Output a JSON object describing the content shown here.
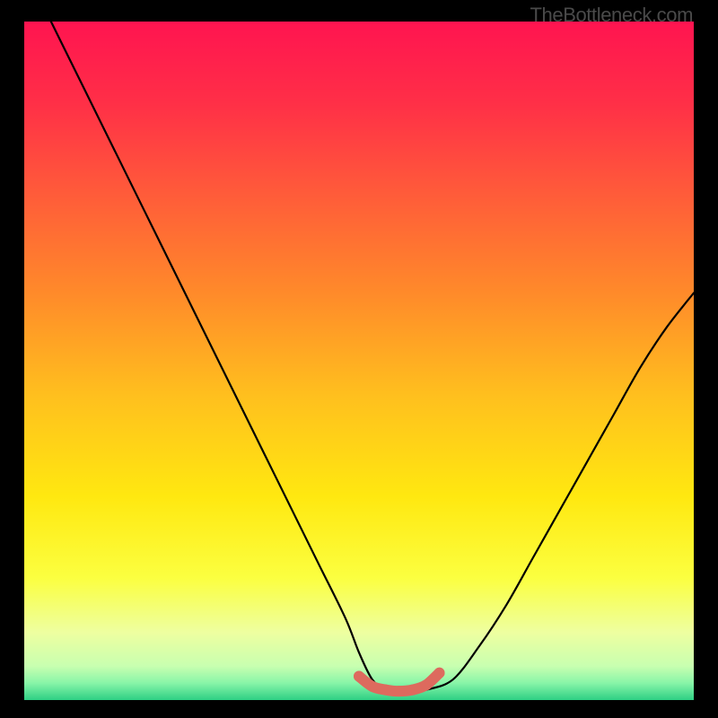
{
  "watermark": "TheBottleneck.com",
  "chart_data": {
    "type": "line",
    "title": "",
    "xlabel": "",
    "ylabel": "",
    "xlim": [
      0,
      100
    ],
    "ylim": [
      0,
      100
    ],
    "background": {
      "type": "vertical-gradient",
      "stops": [
        {
          "pos": 0.0,
          "color": "#ff1450"
        },
        {
          "pos": 0.12,
          "color": "#ff2f47"
        },
        {
          "pos": 0.25,
          "color": "#ff5a3a"
        },
        {
          "pos": 0.4,
          "color": "#ff8a2a"
        },
        {
          "pos": 0.55,
          "color": "#ffbf1e"
        },
        {
          "pos": 0.7,
          "color": "#ffe810"
        },
        {
          "pos": 0.82,
          "color": "#fbff40"
        },
        {
          "pos": 0.9,
          "color": "#eeffa0"
        },
        {
          "pos": 0.95,
          "color": "#c8ffb0"
        },
        {
          "pos": 0.975,
          "color": "#88f5a8"
        },
        {
          "pos": 1.0,
          "color": "#2ecf84"
        }
      ]
    },
    "series": [
      {
        "name": "bottleneck-curve",
        "color": "#000000",
        "x": [
          4,
          8,
          12,
          16,
          20,
          24,
          28,
          32,
          36,
          40,
          44,
          48,
          50,
          52,
          54,
          56,
          58,
          60,
          64,
          68,
          72,
          76,
          80,
          84,
          88,
          92,
          96,
          100
        ],
        "y": [
          100,
          92,
          84,
          76,
          68,
          60,
          52,
          44,
          36,
          28,
          20,
          12,
          7,
          3,
          1.5,
          1.2,
          1.2,
          1.5,
          3,
          8,
          14,
          21,
          28,
          35,
          42,
          49,
          55,
          60
        ]
      },
      {
        "name": "sweet-spot-highlight",
        "color": "#e06a60",
        "x": [
          50,
          52,
          54,
          56,
          58,
          60,
          62
        ],
        "y": [
          3.5,
          2.0,
          1.5,
          1.3,
          1.5,
          2.2,
          4.0
        ]
      }
    ],
    "annotations": []
  }
}
